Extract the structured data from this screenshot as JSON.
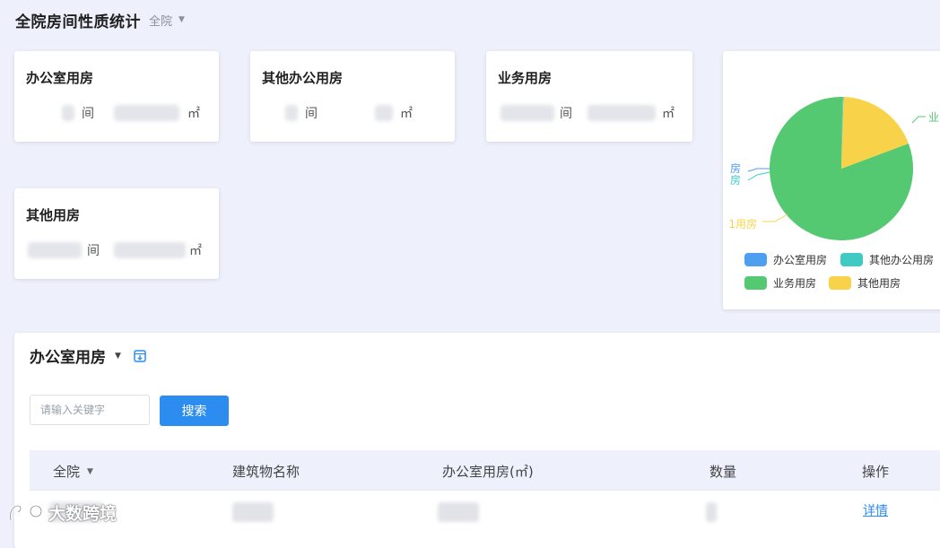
{
  "header": {
    "title": "全院房间性质统计",
    "scope": "全院"
  },
  "cards": [
    {
      "title": "办公室用房",
      "count_unit": "间",
      "area_unit": "㎡"
    },
    {
      "title": "其他办公用房",
      "count_unit": "间",
      "area_unit": "㎡"
    },
    {
      "title": "业务用房",
      "count_unit": "间",
      "area_unit": "㎡"
    },
    {
      "title": "其他用房",
      "count_unit": "间",
      "area_unit": "㎡"
    }
  ],
  "chart_data": {
    "type": "pie",
    "slices": [
      {
        "name": "办公室用房",
        "value": 0.1,
        "color": "#4e9ef2"
      },
      {
        "name": "其他办公用房",
        "value": 0.1,
        "color": "#3fcac4"
      },
      {
        "name": "业务用房",
        "value": 81,
        "color": "#55c972"
      },
      {
        "name": "其他用房",
        "value": 18.8,
        "color": "#f8d34a"
      }
    ],
    "visible_labels": {
      "right": "业",
      "left1": "房",
      "left2": "房",
      "bottom": "1用房"
    },
    "legend": [
      "办公室用房",
      "其他办公用房",
      "业务用房",
      "其他用房"
    ],
    "legend_position": "bottom"
  },
  "panel": {
    "title": "办公室用房",
    "search": {
      "placeholder": "请输入关键字",
      "button": "搜索"
    },
    "columns": [
      "全院",
      "建筑物名称",
      "办公室用房(㎡)",
      "数量",
      "操作"
    ],
    "rows": [
      {
        "action": "详情"
      }
    ]
  },
  "watermark": "大数跨境"
}
